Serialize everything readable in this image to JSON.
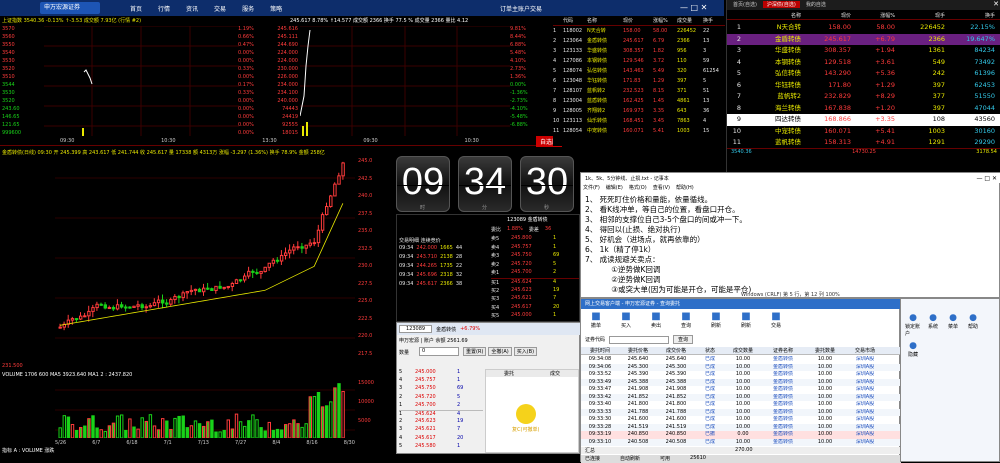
{
  "topbar": {
    "brand": "申万宏源证券",
    "menu": [
      "首页",
      "行情",
      "资讯",
      "交易",
      "服务",
      "策略"
    ],
    "right_status": "订单主账户交易",
    "rh_buttons": [
      "自选",
      "交易"
    ]
  },
  "top_chart": {
    "header_left": "上证指数 3540.36 -0.13% ↑-3.53 成交额 7.93亿 (行情 #2)",
    "header_mid": "245.617 8.78% ↑14.577 成交额 2366 换手 77.5 % 成交量 2366 量比 4.12",
    "left_axis": [
      "3570",
      "3560",
      "3550",
      "3540",
      "3530",
      "3520",
      "3510",
      "3544",
      "3530",
      "3520",
      "243.60",
      "146.65",
      "121.65",
      "999600"
    ],
    "center_right": [
      "1.19%",
      "0.66%",
      "0.47%",
      "0.00%",
      "0.00%",
      "0.33%",
      "0.00%",
      "0.17%",
      "0.33%",
      "0.00%",
      "0.00%",
      "0.00%",
      "0.00%",
      "0.00%"
    ],
    "center_vals": [
      "245.616",
      "245.111",
      "244.690",
      "224.000",
      "224.000",
      "230.000",
      "226.000",
      "234.000",
      "234.100",
      "240.000",
      "74443",
      "24419",
      "92555",
      "18015"
    ],
    "right_pct": [
      "9.81%",
      "8.44%",
      "6.88%",
      "5.48%",
      "4.10%",
      "2.73%",
      "1.36%",
      "0.00%",
      "-1.36%",
      "-2.73%",
      "-4.10%",
      "-5.48%",
      "-6.88%"
    ],
    "time_axis": [
      "09:30",
      "10:30",
      "13:30",
      "09:30",
      "10:30",
      "13:30"
    ],
    "sell_badge": "自选股"
  },
  "quote_table": {
    "headers": [
      "",
      "代码",
      "名称",
      "",
      "现价",
      "涨幅%",
      "成交量",
      "换手"
    ],
    "rows": [
      {
        "n": "1",
        "code": "118002",
        "name": "N天合转",
        "price": "158.00",
        "chg": "58.00",
        "vol": "226452",
        "turn": "22"
      },
      {
        "n": "2",
        "code": "123064",
        "name": "金盾转债",
        "price": "245.617",
        "chg": "6.79",
        "vol": "2366",
        "turn": "13"
      },
      {
        "n": "3",
        "code": "123133",
        "name": "华盛转债",
        "price": "308.357",
        "chg": "1.82",
        "vol": "956",
        "turn": "3"
      },
      {
        "n": "4",
        "code": "127086",
        "name": "本钢转债",
        "price": "129.546",
        "chg": "3.72",
        "vol": "110",
        "turn": "59"
      },
      {
        "n": "5",
        "code": "128074",
        "name": "弘信转债",
        "price": "143.463",
        "chg": "5.49",
        "vol": "320",
        "turn": "61254"
      },
      {
        "n": "6",
        "code": "123048",
        "name": "华钰转债",
        "price": "171.83",
        "chg": "1.29",
        "turn": "5",
        "vol": "397"
      },
      {
        "n": "7",
        "code": "128107",
        "name": "蓝帆转2",
        "price": "232.523",
        "chg": "8.15",
        "vol": "371",
        "turn": "51"
      },
      {
        "n": "8",
        "code": "123004",
        "name": "蓝盾转债",
        "price": "162.425",
        "chg": "1.45",
        "vol": "4861",
        "turn": "13"
      },
      {
        "n": "9",
        "code": "128005",
        "name": "齐翔转2",
        "price": "169.973",
        "chg": "3.35",
        "vol": "643",
        "turn": "36"
      },
      {
        "n": "10",
        "code": "123113",
        "name": "仙乐转债",
        "price": "168.451",
        "chg": "3.45",
        "vol": "7863",
        "turn": "4"
      },
      {
        "n": "11",
        "code": "128054",
        "name": "中宠转债",
        "price": "160.071",
        "chg": "5.41",
        "vol": "1003",
        "turn": "15"
      }
    ]
  },
  "right_panel": {
    "tabs": [
      "首页(自选)",
      "沪深债(自选)",
      "我的自选"
    ],
    "headers": [
      "",
      "名称",
      "现价",
      "涨幅%",
      "现手",
      "换手"
    ],
    "rows": [
      {
        "n": "1",
        "name": "N天合转",
        "price": "158.00",
        "chg": "58.00",
        "vol": "226452",
        "turn": "22.15%"
      },
      {
        "n": "2",
        "name": "金盾转债",
        "price": "245.617",
        "chg": "+6.79",
        "vol": "2366",
        "turn": "19.647%"
      },
      {
        "n": "3",
        "name": "华盛转债",
        "price": "308.357",
        "chg": "+1.94",
        "vol": "1361",
        "turn": "84234"
      },
      {
        "n": "4",
        "name": "本钢转债",
        "price": "129.518",
        "chg": "+3.61",
        "vol": "549",
        "turn": "73492"
      },
      {
        "n": "5",
        "name": "弘信转债",
        "price": "143.290",
        "chg": "+5.36",
        "vol": "242",
        "turn": "61396"
      },
      {
        "n": "6",
        "name": "华钰转债",
        "price": "171.80",
        "chg": "+1.29",
        "vol": "397",
        "turn": "62453"
      },
      {
        "n": "7",
        "name": "蓝帆转2",
        "price": "232.829",
        "chg": "+8.29",
        "vol": "377",
        "turn": "51550"
      },
      {
        "n": "8",
        "name": "海兰转债",
        "price": "167.838",
        "chg": "+1.20",
        "vol": "397",
        "turn": "47044"
      },
      {
        "n": "9",
        "name": "四达转债",
        "price": "168.866",
        "chg": "+3.35",
        "vol": "108",
        "turn": "43560"
      },
      {
        "n": "10",
        "name": "中宠转债",
        "price": "160.071",
        "chg": "+5.41",
        "vol": "1003",
        "turn": "30160"
      },
      {
        "n": "11",
        "name": "蓝帆转债",
        "price": "158.313",
        "chg": "+4.91",
        "vol": "1291",
        "turn": "29290"
      }
    ],
    "footer_left": "3540.36",
    "footer_mid": "14730.25",
    "footer_right": "3178.54"
  },
  "kline": {
    "header": "金盾转债(日线) 09:30 开 245.399 高 243.617 低 241.744 收 245.617 量 17338 额 4313万 涨幅 -3.297 (1.36%) 换手 78.9% 金额 258亿",
    "y_axis": [
      "245.0",
      "242.5",
      "240.0",
      "237.5",
      "235.0",
      "232.5",
      "230.0",
      "227.5",
      "225.0",
      "222.5",
      "220.0",
      "217.5"
    ],
    "mid": "231.500",
    "vol_header": "VOLUME 1706 600 MA5 3923.640 MA1 2 : 2437.820",
    "vol_axis": [
      "15000",
      "10000",
      "5000"
    ],
    "dates": [
      "5/26",
      "6/7",
      "6/18",
      "7/1",
      "7/13",
      "7/27",
      "8/4",
      "8/16",
      "8/30"
    ],
    "footer": "指标 A : VOLUME 涨跌"
  },
  "flipclock": {
    "hours": "09",
    "minutes": "34",
    "seconds": "30",
    "sub": [
      "时",
      "分",
      "秒"
    ]
  },
  "ticker": {
    "code_line": "123089 金盾转债",
    "stats": [
      {
        "label": "委比",
        "val": "1.88%"
      },
      {
        "label": "委差",
        "val": "36"
      }
    ],
    "trades_header": "交易明细  连续竞价",
    "trades": [
      {
        "t": "09:34",
        "p": "242.000",
        "v": "1665",
        "d": "44"
      },
      {
        "t": "09:34",
        "p": "243.710",
        "v": "2138",
        "d": "28"
      },
      {
        "t": "09:34",
        "p": "244.265",
        "v": "1735",
        "d": "22"
      },
      {
        "t": "09:34",
        "p": "245.696",
        "v": "2318",
        "d": "32"
      },
      {
        "t": "09:34",
        "p": "245.617",
        "v": "2366",
        "d": "38"
      }
    ],
    "book": [
      {
        "l": "卖5",
        "p": "245.800",
        "v": "1"
      },
      {
        "l": "卖4",
        "p": "245.757",
        "v": "1"
      },
      {
        "l": "卖3",
        "p": "245.750",
        "v": "69"
      },
      {
        "l": "卖2",
        "p": "245.720",
        "v": "5"
      },
      {
        "l": "卖1",
        "p": "245.700",
        "v": "2"
      },
      {
        "l": "买1",
        "p": "245.624",
        "v": "4"
      },
      {
        "l": "买2",
        "p": "245.623",
        "v": "19"
      },
      {
        "l": "买3",
        "p": "245.621",
        "v": "7"
      },
      {
        "l": "买4",
        "p": "245.617",
        "v": "20"
      },
      {
        "l": "买5",
        "p": "245.000",
        "v": "1"
      }
    ]
  },
  "notepad": {
    "title": "1k、5k、5分钟线、止损.txt - 记事本",
    "menu": [
      "文件(F)",
      "编辑(E)",
      "格式(O)",
      "查看(V)",
      "帮助(H)"
    ],
    "lines": [
      "1、 死死盯住价格和量能，依量循线。",
      "2、 看K线冲单，等自己的位置，看盘口开仓。",
      "3、 相邻的支撑位自己3-5个盘口的间或冲一下。",
      "4、 得回以(止损、绝对执行)",
      "5、 好机会（进场点，就再依靠的）",
      "6、 1k（精了停1k）",
      "7、 成读规避关卖点：",
      "           ①逆势做K回调",
      "           ②逆势做K回调",
      "           ③或突大单(因为可能是开仓，可能是平仓)"
    ],
    "status": "Windows (CRLF)   第 5 行，第 12 列    100%"
  },
  "trade": {
    "title": "网上交易客户端 - 申万宏源证券",
    "tabs": [
      "委托",
      "撤单",
      "查询",
      "刷新"
    ],
    "code_field": "123089",
    "name": "金盾转债",
    "price": "245.617",
    "pct": "+6.79%",
    "acct_line": "申万宏源 | 账户 余额 2561.69",
    "qty_label": "数量",
    "qty_val": "0",
    "buttons": [
      "重置(R)",
      "全撤(A)",
      "买入(B)"
    ],
    "book": [
      {
        "l": "5",
        "p": "245.000",
        "v": "1"
      },
      {
        "l": "4",
        "p": "245.757",
        "v": "1"
      },
      {
        "l": "3",
        "p": "245.750",
        "v": "69"
      },
      {
        "l": "2",
        "p": "245.720",
        "v": "5"
      },
      {
        "l": "1",
        "p": "245.700",
        "v": "2"
      },
      {
        "l": "1",
        "p": "245.624",
        "v": "4"
      },
      {
        "l": "2",
        "p": "245.623",
        "v": "19"
      },
      {
        "l": "3",
        "p": "245.621",
        "v": "7"
      },
      {
        "l": "4",
        "p": "245.617",
        "v": "20"
      },
      {
        "l": "5",
        "p": "245.580",
        "v": "1"
      }
    ],
    "tab_b": [
      "委托",
      "成交"
    ],
    "badge": "复C(可撤单)"
  },
  "orders": {
    "title": "网上交易客户端 - 申万宏源证券 - 查询委托",
    "toolbar": [
      "撤单",
      "买入",
      "卖出",
      "查询",
      "刷新",
      "刷新",
      "交易"
    ],
    "right_tools": [
      "锁定账户",
      "系统",
      "菜单",
      "帮助",
      "隐藏"
    ],
    "filter_label": "证券代码",
    "filter_btn": "查询",
    "headers": [
      "委托时间",
      "委托价格",
      "成交价格",
      "状态",
      "成交数量",
      "证券名称",
      "委托数量",
      "交易市场"
    ],
    "rows": [
      {
        "t": "09:34:08",
        "p": "245.640",
        "cp": "245.640",
        "s": "已成",
        "n": "10.00",
        "name": "金盾转债",
        "q": "10.00",
        "m": "深圳A股"
      },
      {
        "t": "09:34:06",
        "p": "245.300",
        "cp": "245.300",
        "s": "已成",
        "n": "10.00",
        "name": "金盾转债",
        "q": "10.00",
        "m": "深圳A股"
      },
      {
        "t": "09:33:52",
        "p": "245.390",
        "cp": "245.390",
        "s": "已成",
        "n": "10.00",
        "name": "金盾转债",
        "q": "10.00",
        "m": "深圳A股"
      },
      {
        "t": "09:33:49",
        "p": "245.388",
        "cp": "245.388",
        "s": "已成",
        "n": "10.00",
        "name": "金盾转债",
        "q": "10.00",
        "m": "深圳A股"
      },
      {
        "t": "09:33:47",
        "p": "241.908",
        "cp": "241.908",
        "s": "已成",
        "n": "10.00",
        "name": "金盾转债",
        "q": "10.00",
        "m": "深圳A股"
      },
      {
        "t": "09:33:42",
        "p": "241.852",
        "cp": "241.852",
        "s": "已成",
        "n": "10.00",
        "name": "金盾转债",
        "q": "10.00",
        "m": "深圳A股"
      },
      {
        "t": "09:33:40",
        "p": "241.800",
        "cp": "241.800",
        "s": "已成",
        "n": "10.00",
        "name": "金盾转债",
        "q": "10.00",
        "m": "深圳A股"
      },
      {
        "t": "09:33:33",
        "p": "241.788",
        "cp": "241.788",
        "s": "已成",
        "n": "10.00",
        "name": "金盾转债",
        "q": "10.00",
        "m": "深圳A股"
      },
      {
        "t": "09:33:30",
        "p": "241.600",
        "cp": "241.600",
        "s": "已成",
        "n": "10.00",
        "name": "金盾转债",
        "q": "10.00",
        "m": "深圳A股"
      },
      {
        "t": "09:33:28",
        "p": "241.519",
        "cp": "241.519",
        "s": "已成",
        "n": "10.00",
        "name": "金盾转债",
        "q": "10.00",
        "m": "深圳A股"
      },
      {
        "t": "09:33:19",
        "p": "240.850",
        "cp": "240.850",
        "s": "已撤",
        "n": "0.00",
        "name": "金盾转债",
        "q": "10.00",
        "m": "深圳A股"
      },
      {
        "t": "09:33:10",
        "p": "240.508",
        "cp": "240.508",
        "s": "已成",
        "n": "10.00",
        "name": "金盾转债",
        "q": "10.00",
        "m": "深圳A股"
      }
    ],
    "total_label": "汇总",
    "total": "270.00",
    "status": [
      "已连接",
      "自动刷新",
      "可用",
      "25610"
    ]
  },
  "taskbar": {
    "left": "申万宏源证券",
    "mid": "已连接  自动刷新",
    "right": "可用金额"
  }
}
